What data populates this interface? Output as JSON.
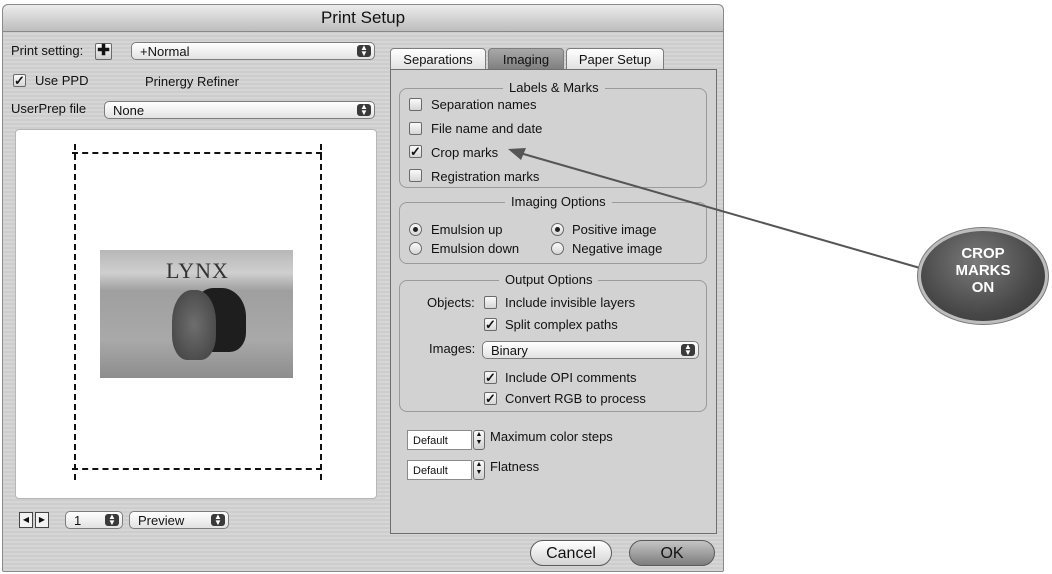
{
  "window": {
    "title": "Print Setup"
  },
  "left": {
    "print_setting_label": "Print setting:",
    "print_setting_value": "+Normal",
    "use_ppd_label": "Use PPD",
    "use_ppd_checked": true,
    "ppd_name": "Prinergy Refiner",
    "userprep_label": "UserPrep file",
    "userprep_value": "None",
    "preview_image_text": "LYNX",
    "page_number": "1",
    "view_mode": "Preview"
  },
  "tabs": [
    {
      "label": "Separations",
      "active": false
    },
    {
      "label": "Imaging",
      "active": true
    },
    {
      "label": "Paper Setup",
      "active": false
    }
  ],
  "labels_marks": {
    "title": "Labels & Marks",
    "items": [
      {
        "label": "Separation names",
        "checked": false
      },
      {
        "label": "File name and date",
        "checked": false
      },
      {
        "label": "Crop marks",
        "checked": true
      },
      {
        "label": "Registration marks",
        "checked": false
      }
    ]
  },
  "imaging_options": {
    "title": "Imaging Options",
    "radios": [
      {
        "label": "Emulsion up",
        "selected": true
      },
      {
        "label": "Positive image",
        "selected": true
      },
      {
        "label": "Emulsion down",
        "selected": false
      },
      {
        "label": "Negative image",
        "selected": false
      }
    ]
  },
  "output_options": {
    "title": "Output Options",
    "objects_label": "Objects:",
    "include_invisible_label": "Include invisible layers",
    "include_invisible_checked": false,
    "split_paths_label": "Split complex paths",
    "split_paths_checked": true,
    "images_label": "Images:",
    "images_value": "Binary",
    "include_opi_label": "Include OPI comments",
    "include_opi_checked": true,
    "convert_rgb_label": "Convert RGB to process",
    "convert_rgb_checked": true
  },
  "steps": {
    "value": "Default",
    "label": "Maximum color steps"
  },
  "flatness": {
    "value": "Default",
    "label": "Flatness"
  },
  "buttons": {
    "cancel": "Cancel",
    "ok": "OK"
  },
  "callout": {
    "line1": "CROP",
    "line2": "MARKS",
    "line3": "ON"
  },
  "colors": {
    "badge": "#474747",
    "ok_button": "#8c8c8c",
    "active_tab": "#8a8a8a"
  }
}
